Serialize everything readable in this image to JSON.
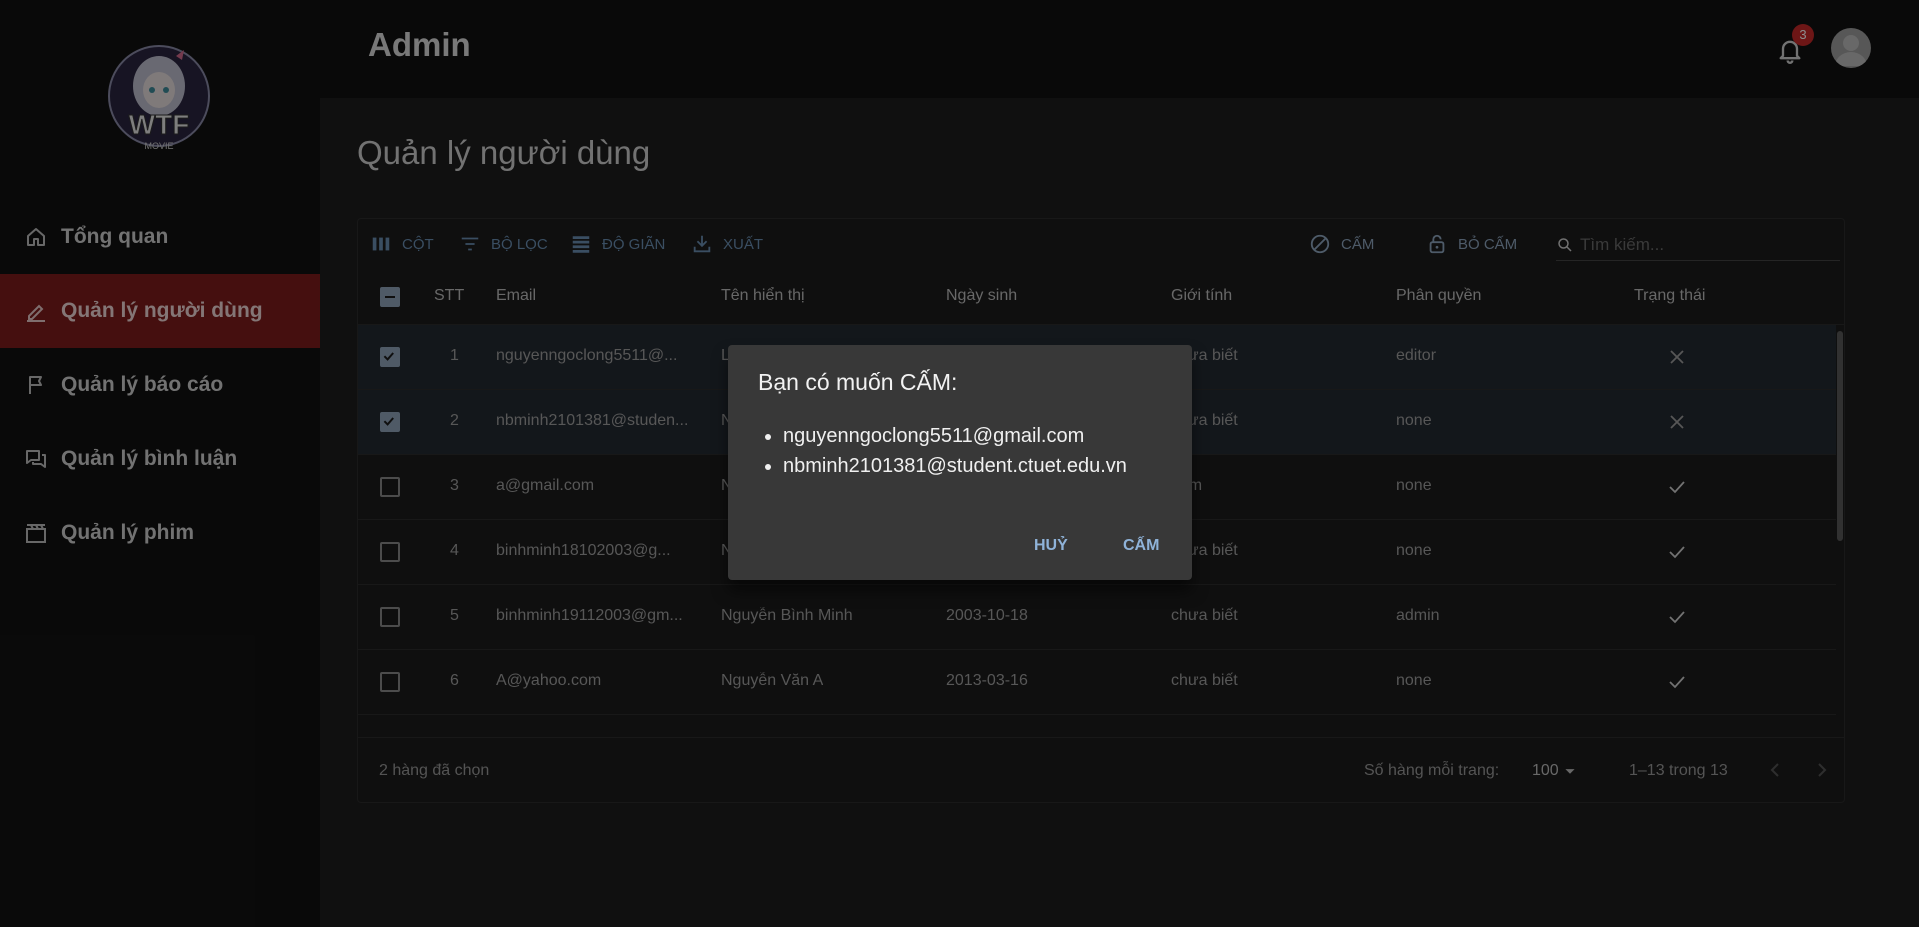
{
  "header": {
    "title": "Admin",
    "notification_count": "3"
  },
  "logo": {
    "text": "WTF",
    "subtext": "MOVIE"
  },
  "sidebar": {
    "items": [
      {
        "label": "Tổng quan",
        "icon": "home-icon",
        "active": false
      },
      {
        "label": "Quản lý người dùng",
        "icon": "edit-icon",
        "active": true
      },
      {
        "label": "Quản lý báo cáo",
        "icon": "flag-icon",
        "active": false
      },
      {
        "label": "Quản lý bình luận",
        "icon": "forum-icon",
        "active": false
      },
      {
        "label": "Quản lý phim",
        "icon": "movie-icon",
        "active": false
      }
    ]
  },
  "page": {
    "title": "Quản lý người dùng"
  },
  "toolbar": {
    "columns": "CỘT",
    "filter": "BỘ LỌC",
    "density": "ĐỘ GIÃN",
    "export": "XUẤT",
    "ban": "CẤM",
    "unban": "BỎ CẤM",
    "search_placeholder": "Tìm kiếm..."
  },
  "table": {
    "headers": {
      "stt": "STT",
      "email": "Email",
      "display_name": "Tên hiển thị",
      "birthday": "Ngày sinh",
      "gender": "Giới tính",
      "role": "Phân quyền",
      "status": "Trạng thái"
    },
    "rows": [
      {
        "stt": "1",
        "email": "nguyenngoclong5511@...",
        "name": "L",
        "birthday": "",
        "gender": "chưa biết",
        "role": "editor",
        "status": "banned",
        "selected": true
      },
      {
        "stt": "2",
        "email": "nbminh2101381@studen...",
        "name": "N",
        "birthday": "",
        "gender": "chưa biết",
        "role": "none",
        "status": "banned",
        "selected": true
      },
      {
        "stt": "3",
        "email": "a@gmail.com",
        "name": "N",
        "birthday": "",
        "gender": "nam",
        "role": "none",
        "status": "active",
        "selected": false
      },
      {
        "stt": "4",
        "email": "binhminh18102003@g...",
        "name": "N",
        "birthday": "",
        "gender": "chưa biết",
        "role": "none",
        "status": "active",
        "selected": false
      },
      {
        "stt": "5",
        "email": "binhminh19112003@gm...",
        "name": "Nguyễn Bình Minh",
        "birthday": "2003-10-18",
        "gender": "chưa biết",
        "role": "admin",
        "status": "active",
        "selected": false
      },
      {
        "stt": "6",
        "email": "A@yahoo.com",
        "name": "Nguyễn Văn A",
        "birthday": "2013-03-16",
        "gender": "chưa biết",
        "role": "none",
        "status": "active",
        "selected": false
      }
    ]
  },
  "footer": {
    "selected_text": "2 hàng đã chọn",
    "rows_per_page_label": "Số hàng mỗi trang:",
    "rows_per_page_value": "100",
    "range_text": "1–13 trong 13"
  },
  "dialog": {
    "title": "Bạn có muốn CẤM:",
    "emails": [
      "nguyenngoclong5511@gmail.com",
      "nbminh2101381@student.ctuet.edu.vn"
    ],
    "cancel_label": "HUỶ",
    "confirm_label": "CẤM"
  },
  "colors": {
    "active_nav": "#7e1c1c",
    "accent": "#6a8fb3",
    "badge": "#c62828"
  }
}
